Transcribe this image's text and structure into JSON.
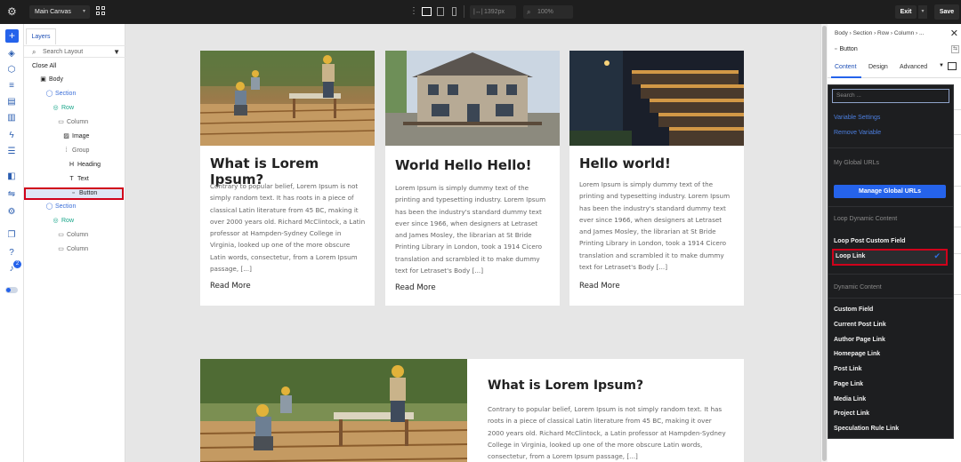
{
  "topbar": {
    "canvas_select": "Main Canvas",
    "width_value": "1392px",
    "zoom_value": "100%",
    "exit_label": "Exit",
    "save_label": "Save"
  },
  "rail": {
    "badge_count": "2",
    "icons": [
      "add-icon",
      "layers-icon",
      "box-icon",
      "database-icon",
      "page-icon",
      "template-icon",
      "lightning-icon",
      "sliders-icon",
      "puzzle-icon",
      "dynamic-icon",
      "settings-data-icon",
      "copy-icon",
      "help-icon",
      "notification-icon",
      "toggle-icon"
    ]
  },
  "layers": {
    "tab_label": "Layers",
    "search_placeholder": "Search Layout",
    "close_all": "Close All",
    "tree": [
      {
        "label": "Body",
        "kind": "el"
      },
      {
        "label": "Section",
        "kind": "section"
      },
      {
        "label": "Row",
        "kind": "row"
      },
      {
        "label": "Column",
        "kind": "col"
      },
      {
        "label": "Image",
        "kind": "el"
      },
      {
        "label": "Group",
        "kind": "col"
      },
      {
        "label": "Heading",
        "kind": "el"
      },
      {
        "label": "Text",
        "kind": "el"
      },
      {
        "label": "Button",
        "kind": "el"
      },
      {
        "label": "Section",
        "kind": "section"
      },
      {
        "label": "Row",
        "kind": "row"
      },
      {
        "label": "Column",
        "kind": "col"
      },
      {
        "label": "Column",
        "kind": "col"
      }
    ]
  },
  "canvas": {
    "cards": [
      {
        "title": "What is Lorem Ipsum?",
        "text": "Contrary to popular belief, Lorem Ipsum is not simply random text. It has roots in a piece of classical Latin literature from 45 BC, making it over 2000 years old. Richard McClintock, a Latin professor at Hampden-Sydney College in Virginia, looked up one of the more obscure Latin words, consectetur, from a Lorem Ipsum passage, [...]",
        "read_more": "Read More"
      },
      {
        "title": "World Hello Hello!",
        "text": "Lorem Ipsum is simply dummy text of the printing and typesetting industry. Lorem Ipsum has been the industry's standard dummy text ever since 1966, when designers at Letraset and James Mosley, the librarian at St Bride Printing Library in London, took a 1914 Cicero translation and scrambled it to make dummy text for Letraset's Body [...]",
        "read_more": "Read More"
      },
      {
        "title": "Hello world!",
        "text": "Lorem Ipsum is simply dummy text of the printing and typesetting industry. Lorem Ipsum has been the industry's standard dummy text ever since 1966, when designers at Letraset and James Mosley, the librarian at St Bride Printing Library in London, took a 1914 Cicero translation and scrambled it to make dummy text for Letraset's Body [...]",
        "read_more": "Read More"
      }
    ],
    "wide": {
      "title": "What is Lorem Ipsum?",
      "text": "Contrary to popular belief, Lorem Ipsum is not simply random text. It has roots in a piece of classical Latin literature from 45 BC, making it over 2000 years old. Richard McClintock, a Latin professor at Hampden-Sydney College in Virginia, looked up one of the more obscure Latin words, consectetur, from a Lorem Ipsum passage, [...]"
    }
  },
  "settings": {
    "breadcrumb": "Body › Section › Row › Column › ...",
    "element_name": "Button",
    "tabs": [
      "Content",
      "Design",
      "Advanced"
    ]
  },
  "dropdown": {
    "search_placeholder": "Search ...",
    "links": [
      "Variable Settings",
      "Remove Variable"
    ],
    "group_global": "My Global URLs",
    "manage_button": "Manage Global URLs",
    "group_loop": "Loop Dynamic Content",
    "loop_items": [
      "Loop Post Custom Field",
      "Loop Link"
    ],
    "selected_item": "Loop Link",
    "group_dynamic": "Dynamic Content",
    "dynamic_items": [
      "Custom Field",
      "Current Post Link",
      "Author Page Link",
      "Homepage Link",
      "Post Link",
      "Page Link",
      "Media Link",
      "Project Link",
      "Speculation Rule Link"
    ]
  },
  "colors": {
    "accent": "#2563eb",
    "highlight": "#d0021b",
    "dark_bg": "#1e1e1e"
  }
}
